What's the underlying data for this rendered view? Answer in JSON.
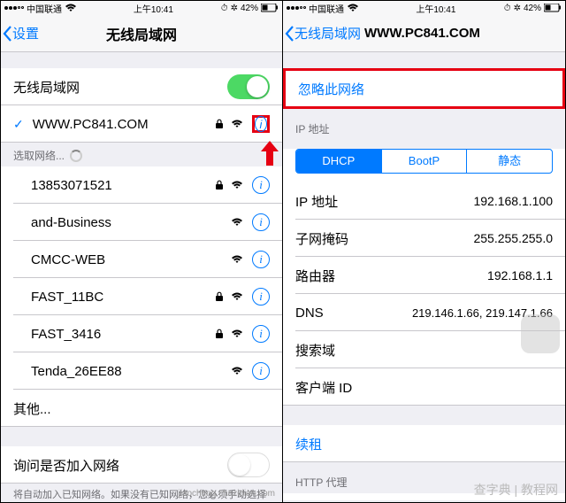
{
  "statusbar": {
    "carrier": "中国联通",
    "time": "上午10:41",
    "alarm": "⏰",
    "battery_pct": "42%"
  },
  "left": {
    "back": "设置",
    "title": "无线局域网",
    "wifi_row_label": "无线局域网",
    "connected": "WWW.PC841.COM",
    "choose_header": "选取网络...",
    "networks": [
      {
        "name": "13853071521",
        "locked": true
      },
      {
        "name": "and-Business",
        "locked": false
      },
      {
        "name": "CMCC-WEB",
        "locked": false
      },
      {
        "name": "FAST_11BC",
        "locked": true
      },
      {
        "name": "FAST_3416",
        "locked": true
      },
      {
        "name": "Tenda_26EE88",
        "locked": false
      }
    ],
    "other": "其他...",
    "ask_join": "询问是否加入网络",
    "ask_note": "将自动加入已知网络。如果没有已知网络，您必须手动选择"
  },
  "right": {
    "back": "无线局域网",
    "title": "WWW.PC841.COM",
    "forget": "忽略此网络",
    "ip_header": "IP 地址",
    "seg": {
      "dhcp": "DHCP",
      "bootp": "BootP",
      "static": "静态"
    },
    "rows": {
      "ip_label": "IP 地址",
      "ip_value": "192.168.1.100",
      "mask_label": "子网掩码",
      "mask_value": "255.255.255.0",
      "router_label": "路由器",
      "router_value": "192.168.1.1",
      "dns_label": "DNS",
      "dns_value": "219.146.1.66, 219.147.1.66",
      "search_label": "搜索域",
      "client_label": "客户端 ID"
    },
    "renew": "续租",
    "proxy_header": "HTTP 代理"
  },
  "watermark_left": "jiaocheng.chazidian.com",
  "watermark_right": "查字典 | 教程网"
}
